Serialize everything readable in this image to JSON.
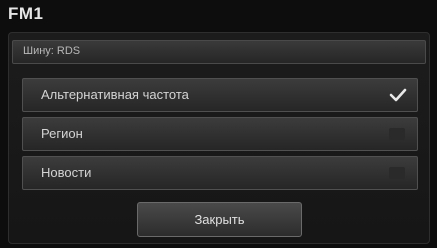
{
  "header": {
    "title": "FM1"
  },
  "panel": {
    "subheader": "Шину: RDS"
  },
  "options": [
    {
      "label": "Альтернативная частота",
      "checked": true
    },
    {
      "label": "Регион",
      "checked": false
    },
    {
      "label": "Новости",
      "checked": false
    }
  ],
  "footer": {
    "close_label": "Закрыть"
  },
  "icons": {
    "check": "checkmark-icon"
  }
}
